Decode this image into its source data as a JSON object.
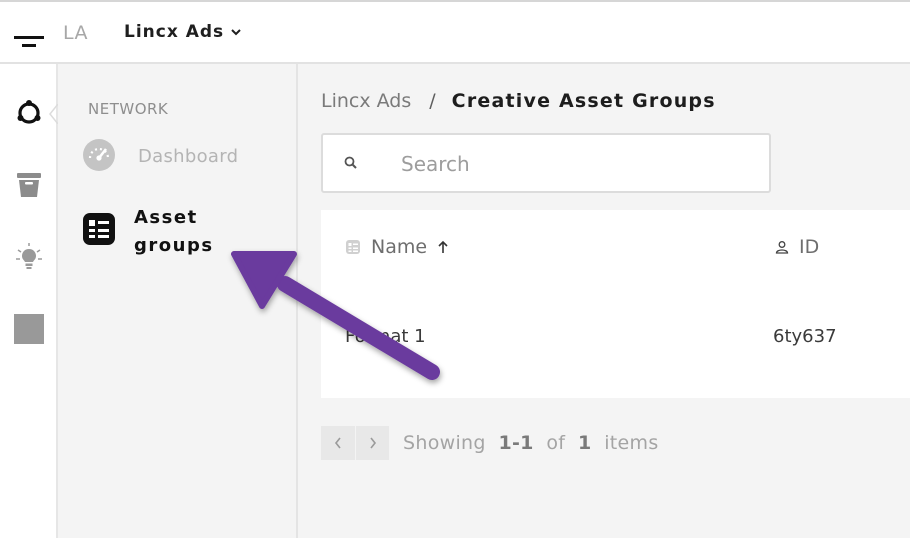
{
  "header": {
    "user_initials": "LA",
    "org_name": "Lincx Ads"
  },
  "sidebar": {
    "section_label": "NETWORK",
    "items": [
      {
        "label": "Dashboard",
        "icon": "dashboard-gauge-icon",
        "active": false
      },
      {
        "label": "Asset groups",
        "icon": "asset-groups-icon",
        "active": true
      }
    ]
  },
  "rail": {
    "icons": [
      "network-icon",
      "bucket-icon",
      "lightbulb-icon",
      "square-icon"
    ]
  },
  "main": {
    "breadcrumb": {
      "org": "Lincx Ads",
      "separator": "/",
      "page": "Creative Asset Groups"
    },
    "search": {
      "placeholder": "Search",
      "value": ""
    },
    "table": {
      "columns": [
        {
          "label": "Name",
          "sort": "asc"
        },
        {
          "label": "ID"
        }
      ],
      "rows": [
        {
          "name": "Format 1",
          "id": "6ty637"
        }
      ]
    },
    "pagination": {
      "prefix": "Showing",
      "range_start": "1",
      "range_end": "1",
      "of_label": "of",
      "total": "1",
      "suffix": "items"
    }
  },
  "colors": {
    "annotation_arrow": "#6b3a9e",
    "active_icon": "#111111",
    "muted_text": "#a4a4a4"
  }
}
